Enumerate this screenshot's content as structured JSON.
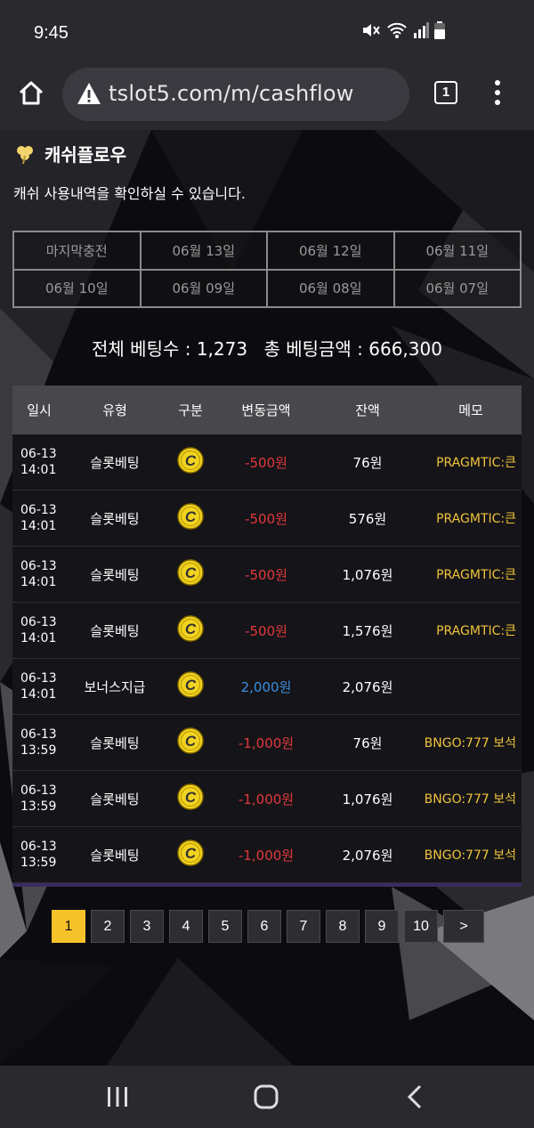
{
  "status": {
    "time": "9:45"
  },
  "browser": {
    "url": "tslot5.com/m/cashflow",
    "tab_count": "1"
  },
  "page": {
    "title": "캐쉬플로우",
    "subtitle": "캐쉬 사용내역을 확인하실 수 있습니다.",
    "date_tabs": [
      "마지막충전",
      "06월 13일",
      "06월 12일",
      "06월 11일",
      "06월 10일",
      "06월 09일",
      "06월 08일",
      "06월 07일"
    ],
    "summary": {
      "total_bets": "전체 베팅수 : 1,273",
      "total_amount": "총 베팅금액 : 666,300"
    },
    "table": {
      "headers": [
        "일시",
        "유형",
        "구분",
        "변동금액",
        "잔액",
        "메모"
      ],
      "rows": [
        {
          "date": "06-13",
          "time": "14:01",
          "type": "슬롯베팅",
          "change": "-500원",
          "balance": "76원",
          "memo": "PRAGMTIC:큰"
        },
        {
          "date": "06-13",
          "time": "14:01",
          "type": "슬롯베팅",
          "change": "-500원",
          "balance": "576원",
          "memo": "PRAGMTIC:큰"
        },
        {
          "date": "06-13",
          "time": "14:01",
          "type": "슬롯베팅",
          "change": "-500원",
          "balance": "1,076원",
          "memo": "PRAGMTIC:큰"
        },
        {
          "date": "06-13",
          "time": "14:01",
          "type": "슬롯베팅",
          "change": "-500원",
          "balance": "1,576원",
          "memo": "PRAGMTIC:큰"
        },
        {
          "date": "06-13",
          "time": "14:01",
          "type": "보너스지급",
          "change": "2,000원",
          "balance": "2,076원",
          "memo": ""
        },
        {
          "date": "06-13",
          "time": "13:59",
          "type": "슬롯베팅",
          "change": "-1,000원",
          "balance": "76원",
          "memo": "BNGO:777 보석"
        },
        {
          "date": "06-13",
          "time": "13:59",
          "type": "슬롯베팅",
          "change": "-1,000원",
          "balance": "1,076원",
          "memo": "BNGO:777 보석"
        },
        {
          "date": "06-13",
          "time": "13:59",
          "type": "슬롯베팅",
          "change": "-1,000원",
          "balance": "2,076원",
          "memo": "BNGO:777 보석"
        }
      ]
    },
    "pagination": [
      "1",
      "2",
      "3",
      "4",
      "5",
      "6",
      "7",
      "8",
      "9",
      "10",
      ">"
    ],
    "coin_letter": "C"
  },
  "colors": {
    "accent": "#f6c22a",
    "negative": "#e0383c",
    "positive": "#3a8fe0",
    "memo": "#f0c33c"
  }
}
